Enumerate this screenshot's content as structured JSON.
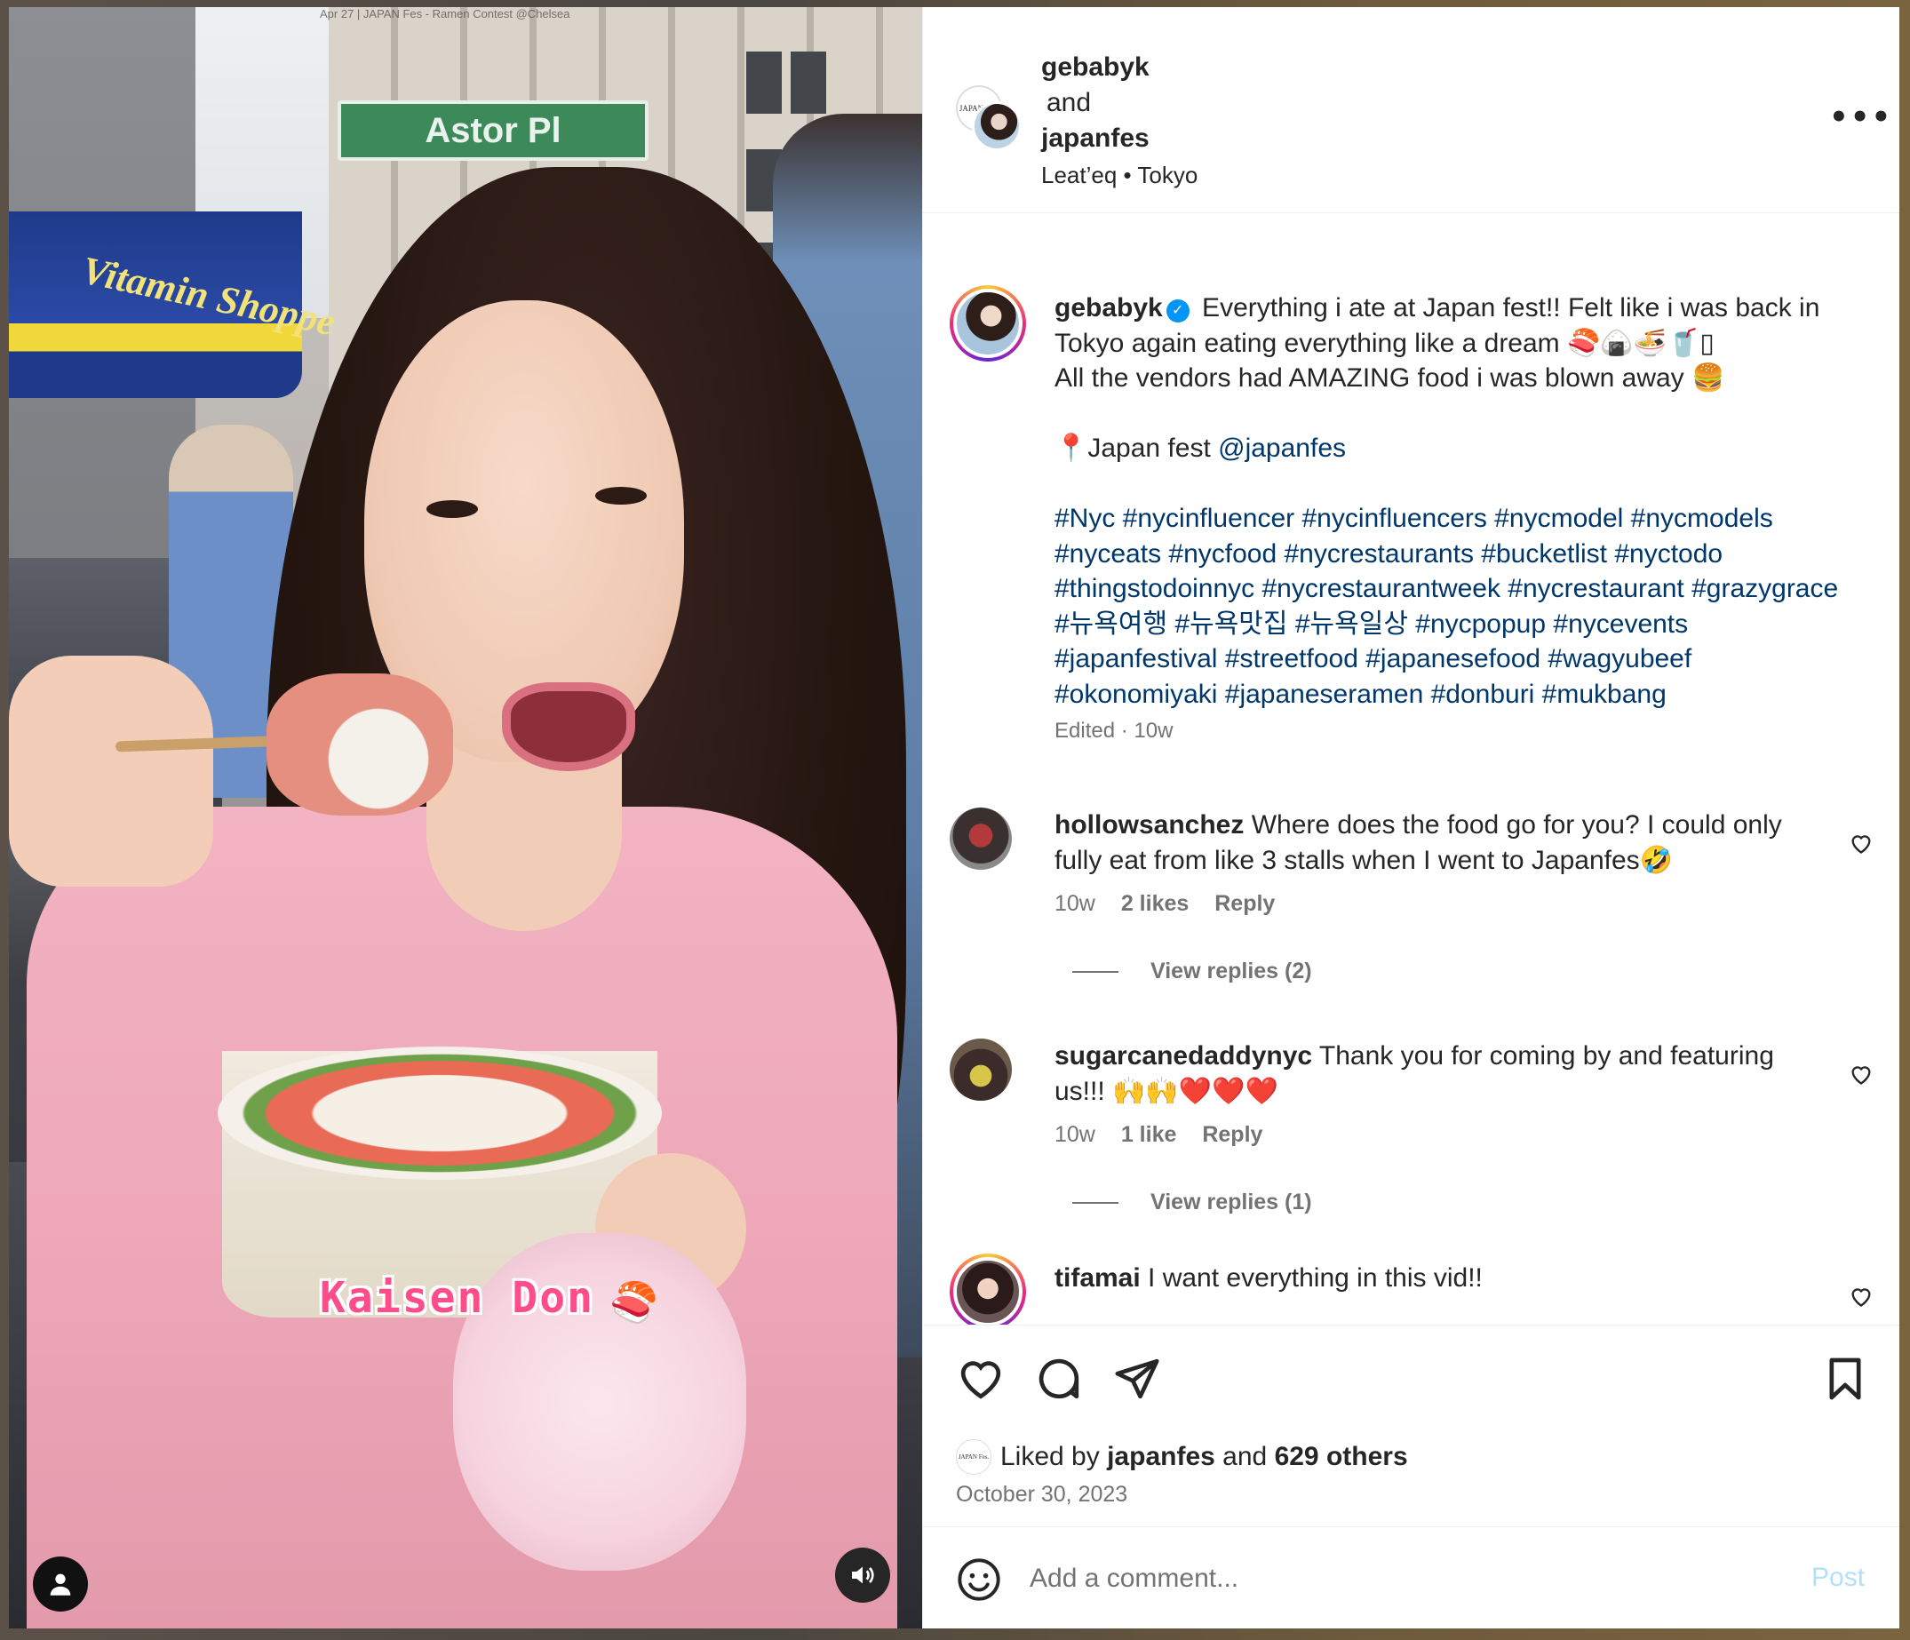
{
  "media": {
    "sign_caption": "Apr 27 | JAPAN Fes - Ramen Contest @Chelsea",
    "street_sign": "Astor Pl",
    "awning_text": "Vitamin Shoppe",
    "overlay_caption": "Kaisen Don",
    "overlay_emoji": "🍣",
    "user_tag_icon": "person-icon",
    "audio_icon": "speaker-icon"
  },
  "header": {
    "user1": "gebabyk",
    "and": "and",
    "user2": "japanfes",
    "location": "Leat’eq • Tokyo",
    "more_icon": "•••"
  },
  "caption": {
    "username": "gebabyk",
    "verified_icon": "✓",
    "line1": " Everything i ate at Japan fest!! Felt like i was back in Tokyo again eating everything like a dream 🍣🍙🍜🥤▯\nAll the vendors had AMAZING food i was blown away 🍔\n\n📍Japan fest ",
    "mention": "@japanfes",
    "hashtags": "#Nyc #nycinfluencer #nycinfluencers #nycmodel #nycmodels #nyceats #nycfood #nycrestaurants #bucketlist #nyctodo #thingstodoinnyc #nycrestaurantweek #nycrestaurant #grazygrace #뉴욕여행 #뉴욕맛집 #뉴욕일상 #nycpopup #nycevents #japanfestival #streetfood #japanesefood #wagyubeef #okonomiyaki #japaneseramen #donburi #mukbang",
    "meta": "Edited · 10w"
  },
  "comments": [
    {
      "username": "hollowsanchez",
      "text": " Where does the food go for you? I could only fully eat from like 3 stalls when I went to Japanfes🤣",
      "time": "10w",
      "likes": "2 likes",
      "reply": "Reply",
      "view_replies": "View replies (2)"
    },
    {
      "username": "sugarcanedaddynyc",
      "text": " Thank you for coming by and featuring us!!! 🙌🙌❤️❤️❤️",
      "time": "10w",
      "likes": "1 like",
      "reply": "Reply",
      "view_replies": "View replies (1)"
    },
    {
      "username": "tifamai",
      "text": " I want everything in this vid!!"
    }
  ],
  "actions": {
    "liked_by_prefix": "Liked by ",
    "liked_by_user": "japanfes",
    "liked_by_and": " and ",
    "liked_by_others": "629 others",
    "date": "October 30, 2023",
    "mini_avatar_text": "JAPAN Fes."
  },
  "add_comment": {
    "placeholder": "Add a comment...",
    "post_label": "Post"
  },
  "colors": {
    "link": "#00376b",
    "verified": "#0095f6",
    "post_disabled": "#b2dffc"
  }
}
